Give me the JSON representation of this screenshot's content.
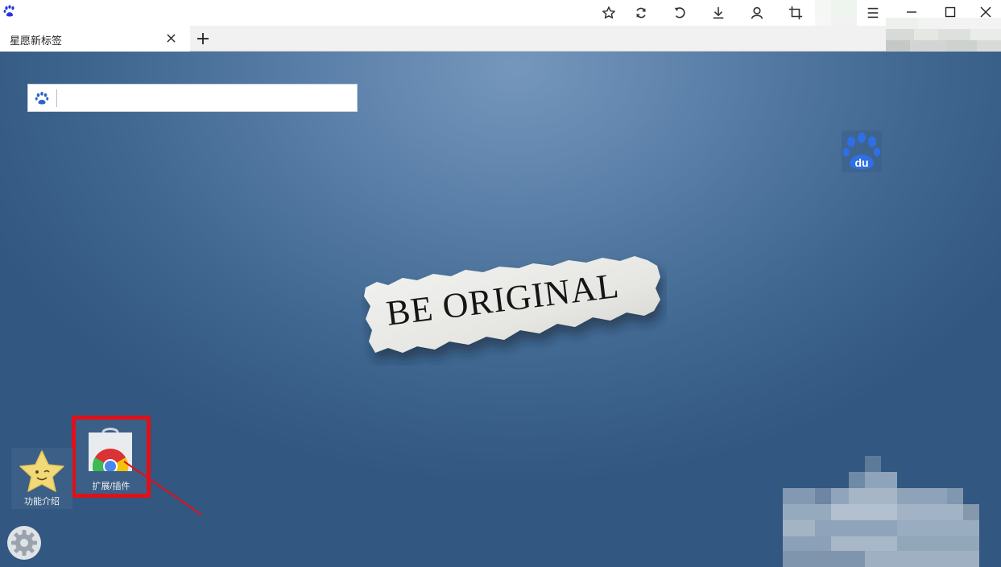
{
  "browser": {
    "app_logo_icon": "baidu-paw-icon",
    "toolbar": [
      {
        "name": "bookmark-star-icon"
      },
      {
        "name": "refresh-icon"
      },
      {
        "name": "undo-icon"
      },
      {
        "name": "download-icon"
      },
      {
        "name": "user-icon"
      },
      {
        "name": "crop-icon"
      },
      {
        "name": "menu-icon"
      }
    ],
    "window_controls": [
      "minimize-icon",
      "maximize-icon",
      "close-icon"
    ]
  },
  "tabs": [
    {
      "title": "星愿新标签",
      "active": true
    }
  ],
  "new_tab_label": "+",
  "newtab": {
    "search": {
      "placeholder": "",
      "value": ""
    },
    "background_text": "BE ORIGINAL",
    "widgets": {
      "extensions_label": "扩展/插件",
      "intro_label": "功能介绍"
    },
    "badge": "du"
  },
  "colors": {
    "highlight_box": "#e0101a",
    "baidu_blue": "#2932e1"
  }
}
